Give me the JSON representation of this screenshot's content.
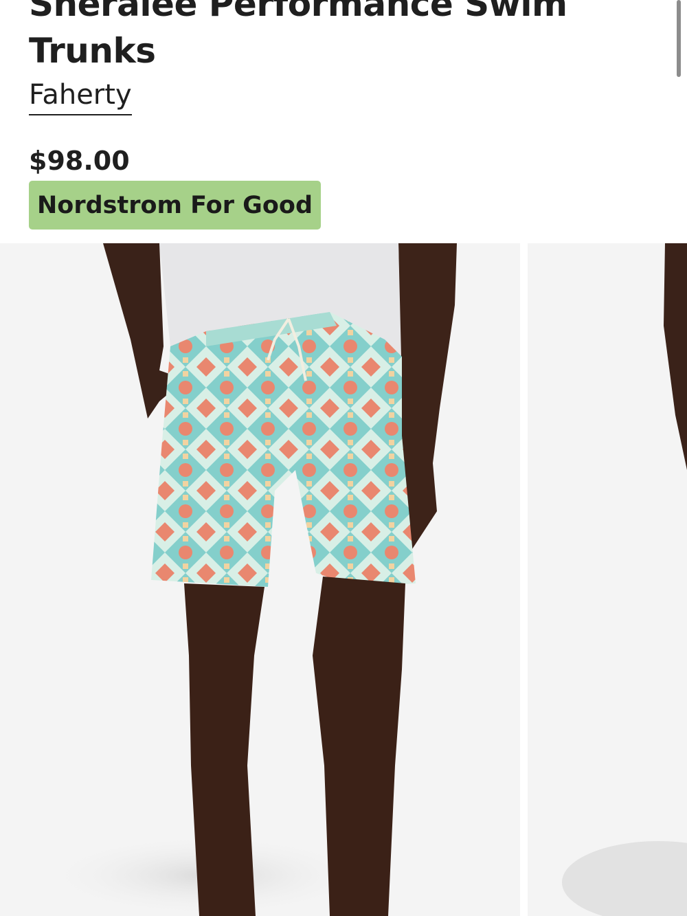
{
  "product": {
    "title_line_1": "Sheralee Performance Swim",
    "title_line_2": "Trunks",
    "brand": "Faherty",
    "price": "$98.00",
    "badge": "Nordstrom For Good"
  },
  "colors": {
    "badge_bg": "#a6d189",
    "text": "#1f1f1f",
    "photo_bg": "#f4f4f4"
  },
  "gallery": {
    "images": [
      {
        "description_icon": "product-photo"
      },
      {
        "description_icon": "product-photo"
      }
    ]
  }
}
